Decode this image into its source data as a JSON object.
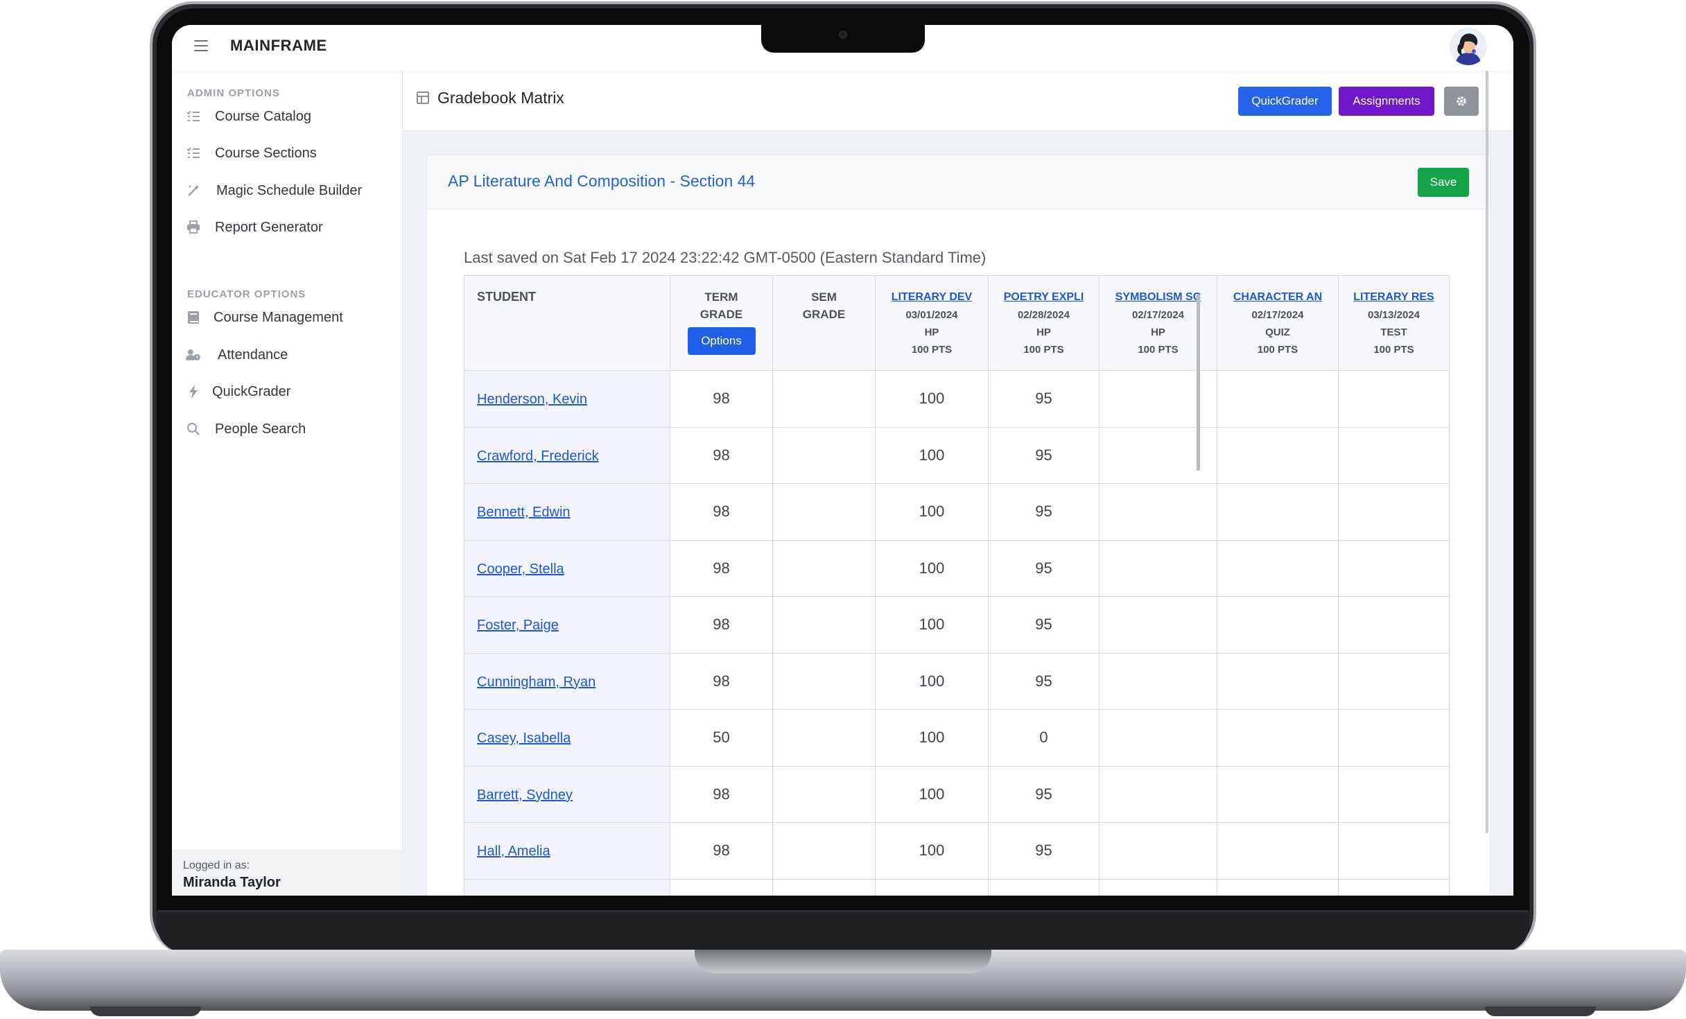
{
  "topbar": {
    "brand": "MAINFRAME"
  },
  "sidebar": {
    "admin_title": "ADMIN OPTIONS",
    "admin_items": [
      {
        "label": "Course Catalog",
        "icon": "list-check-icon"
      },
      {
        "label": "Course Sections",
        "icon": "list-check-icon"
      },
      {
        "label": "Magic Schedule Builder",
        "icon": "magic-wand-icon"
      },
      {
        "label": "Report Generator",
        "icon": "printer-icon"
      }
    ],
    "educator_title": "EDUCATOR OPTIONS",
    "educator_items": [
      {
        "label": "Course Management",
        "icon": "book-icon"
      },
      {
        "label": "Attendance",
        "icon": "user-clock-icon"
      },
      {
        "label": "QuickGrader",
        "icon": "lightning-icon"
      },
      {
        "label": "People Search",
        "icon": "search-icon"
      }
    ],
    "logged_in_caption": "Logged in as:",
    "logged_in_user": "Miranda Taylor"
  },
  "header": {
    "title": "Gradebook Matrix",
    "quickgrader_label": "QuickGrader",
    "assignments_label": "Assignments",
    "settings_icon": "gear-icon"
  },
  "card": {
    "title": "AP Literature And Composition - Section 44",
    "save_label": "Save",
    "last_saved": "Last saved on Sat Feb 17 2024 23:22:42 GMT-0500 (Eastern Standard Time)"
  },
  "gradebook": {
    "student_header": "STUDENT",
    "term_grade_header": [
      "TERM",
      "GRADE"
    ],
    "options_label": "Options",
    "sem_grade_header": [
      "SEM",
      "GRADE"
    ],
    "assignments": [
      {
        "name": "LITERARY DEV",
        "date": "03/01/2024",
        "type": "HP",
        "points": "100 PTS"
      },
      {
        "name": "POETRY EXPLI",
        "date": "02/28/2024",
        "type": "HP",
        "points": "100 PTS"
      },
      {
        "name": "SYMBOLISM SC",
        "date": "02/17/2024",
        "type": "HP",
        "points": "100 PTS"
      },
      {
        "name": "CHARACTER AN",
        "date": "02/17/2024",
        "type": "QUIZ",
        "points": "100 PTS"
      },
      {
        "name": "LITERARY RES",
        "date": "03/13/2024",
        "type": "TEST",
        "points": "100 PTS"
      }
    ],
    "rows": [
      {
        "student": "Henderson, Kevin",
        "term": "98",
        "sem": "",
        "scores": [
          "100",
          "95",
          "",
          "",
          ""
        ]
      },
      {
        "student": "Crawford, Frederick",
        "term": "98",
        "sem": "",
        "scores": [
          "100",
          "95",
          "",
          "",
          ""
        ]
      },
      {
        "student": "Bennett, Edwin",
        "term": "98",
        "sem": "",
        "scores": [
          "100",
          "95",
          "",
          "",
          ""
        ]
      },
      {
        "student": "Cooper, Stella",
        "term": "98",
        "sem": "",
        "scores": [
          "100",
          "95",
          "",
          "",
          ""
        ]
      },
      {
        "student": "Foster, Paige",
        "term": "98",
        "sem": "",
        "scores": [
          "100",
          "95",
          "",
          "",
          ""
        ]
      },
      {
        "student": "Cunningham, Ryan",
        "term": "98",
        "sem": "",
        "scores": [
          "100",
          "95",
          "",
          "",
          ""
        ]
      },
      {
        "student": "Casey, Isabella",
        "term": "50",
        "sem": "",
        "scores": [
          "100",
          "0",
          "",
          "",
          ""
        ]
      },
      {
        "student": "Barrett, Sydney",
        "term": "98",
        "sem": "",
        "scores": [
          "100",
          "95",
          "",
          "",
          ""
        ]
      },
      {
        "student": "Hall, Amelia",
        "term": "98",
        "sem": "",
        "scores": [
          "100",
          "95",
          "",
          "",
          ""
        ]
      },
      {
        "student": "",
        "term": "",
        "sem": "",
        "scores": [
          "",
          "",
          "",
          "",
          ""
        ]
      }
    ]
  }
}
